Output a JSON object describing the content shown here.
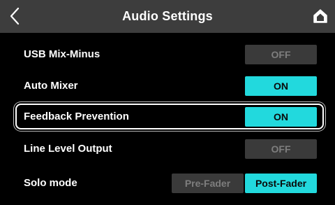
{
  "header": {
    "title": "Audio Settings",
    "back_icon": "chevron-left-icon",
    "home_icon": "home-icon"
  },
  "colors": {
    "header_bg": "#3d3d3d",
    "on_bg": "#22d9dd",
    "off_bg": "#3a3a3a",
    "off_text": "#7e7e7e"
  },
  "settings": [
    {
      "label": "USB Mix-Minus",
      "value": "OFF"
    },
    {
      "label": "Auto Mixer",
      "value": "ON"
    },
    {
      "label": "Feedback Prevention",
      "value": "ON",
      "selected": true
    },
    {
      "label": "Line Level Output",
      "value": "OFF"
    }
  ],
  "solo": {
    "label": "Solo mode",
    "options": [
      "Pre-Fader",
      "Post-Fader"
    ],
    "selected": "Post-Fader"
  }
}
